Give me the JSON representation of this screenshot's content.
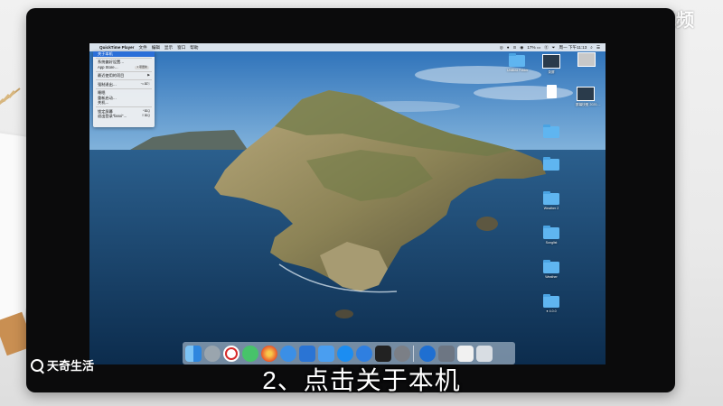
{
  "watermark": "天奇·视频",
  "logo_text": "天奇生活",
  "subtitle": "2、点击关于本机",
  "menubar": {
    "apple": "",
    "app": "QuickTime Player",
    "items": [
      "文件",
      "编辑",
      "显示",
      "窗口",
      "帮助"
    ],
    "right": [
      "◎",
      "●",
      "⊙",
      "◉",
      "17% ▭",
      "Ⓔ",
      "⏷",
      "周一 下午11:13",
      "⌕",
      "☰"
    ]
  },
  "apple_menu": {
    "items": [
      {
        "label": "关于本机",
        "highlighted": true
      },
      {
        "sep": true
      },
      {
        "label": "系统偏好设置…"
      },
      {
        "label": "App Store…",
        "badge": "1 项更新"
      },
      {
        "sep": true
      },
      {
        "label": "最近使用的项目",
        "arrow": "▶"
      },
      {
        "sep": true
      },
      {
        "label": "强制退出…",
        "key": "⌥⌘⎋"
      },
      {
        "sep": true
      },
      {
        "label": "睡眠"
      },
      {
        "label": "重新启动…"
      },
      {
        "label": "关机…"
      },
      {
        "sep": true
      },
      {
        "label": "锁定屏幕",
        "key": "^⌘Q"
      },
      {
        "label": "退出登录“fanxi”…",
        "key": "⇧⌘Q"
      }
    ]
  },
  "desktop_icons": [
    {
      "type": "folder",
      "label": "Untitled Folder"
    },
    {
      "type": "thumb",
      "label": "录屏"
    },
    {
      "type": "thumb",
      "label": ""
    },
    {
      "type": "doc",
      "label": ""
    },
    {
      "type": "thumb",
      "label": "屏幕快照 2020-..."
    },
    {
      "type": "folder",
      "label": ""
    },
    {
      "type": "folder",
      "label": ""
    },
    {
      "type": "folder",
      "label": "Weather 2"
    },
    {
      "type": "folder",
      "label": "Songlist"
    },
    {
      "type": "folder",
      "label": "Weather"
    },
    {
      "type": "folder",
      "label": "●  4.0.0"
    }
  ],
  "dock_apps": [
    "Finder",
    "Launchpad",
    "网易云音乐",
    "微信",
    "Firefox",
    "Safari",
    "Xcode",
    "Files",
    "App Store",
    "Downloads",
    "Terminal",
    "System Preferences",
    "Edge",
    "Preview",
    "TextEdit",
    "Trash"
  ],
  "colors": {
    "menu_highlight": "#2b6fd8",
    "folder": "#5fb5f0",
    "bezel": "#0b0b0c"
  }
}
